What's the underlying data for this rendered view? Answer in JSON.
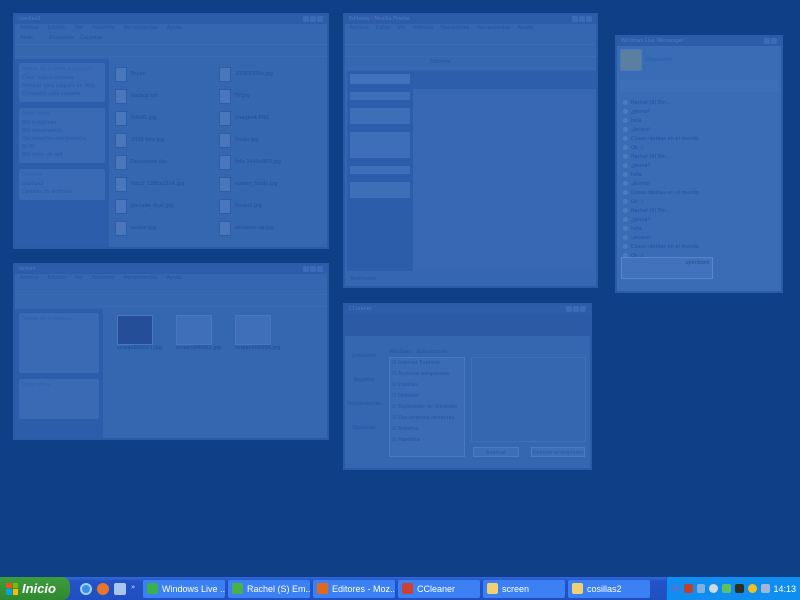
{
  "explorer1": {
    "title": "cosillas2",
    "menu": [
      "Archivo",
      "Edición",
      "Ver",
      "Favoritos",
      "Herramientas",
      "Ayuda"
    ],
    "toolbar": [
      "Atrás",
      "Búsqueda",
      "Carpetas"
    ],
    "tasks_title": "Tareas de archivo y carpeta",
    "tasks": [
      "Crear nueva carpeta",
      "Publicar esta carpeta en Web",
      "Compartir esta carpeta"
    ],
    "places_title": "Otros sitios",
    "places": [
      "Mis imágenes",
      "Mis documentos",
      "Documentos compartidos",
      "Mi PC",
      "Mis sitios de red"
    ],
    "details_title": "Detalles",
    "details": [
      "cosillas2",
      "Carpeta de archivos"
    ],
    "files": [
      "Bryan",
      "20081005b.jpg",
      "backup.txt",
      "TP.jpg",
      "foto01.jpg",
      "imagen4.PNG",
      "2008 foto.jpg",
      "fondo.jpg",
      "Document.doc",
      "foto 1440x900.jpg",
      "foto2_1280x1024.jpg",
      "screen_fondo.jpg",
      "portada_final.jpg",
      "fondo2.jpg",
      "avatar.jpg",
      "windows-xp.jpg"
    ]
  },
  "firefox": {
    "title": "Editores - Mozilla Firefox",
    "menu": [
      "Archivo",
      "Editar",
      "Ver",
      "Historial",
      "Marcadores",
      "Herramientas",
      "Ayuda"
    ],
    "tab": "Editores",
    "status": "Terminado"
  },
  "messenger": {
    "title": "Windows Live Messenger",
    "status": "Disponible",
    "ad_text": "openbank",
    "messages": [
      "Rachel (S) Em...",
      "¿Jenna?",
      "hola",
      "¡ánimo!",
      "Cosas rápidas en el mundo",
      "Ok :)"
    ]
  },
  "explorer2": {
    "title": "screen",
    "menu": [
      "Archivo",
      "Edición",
      "Ver",
      "Favoritos",
      "Herramientas",
      "Ayuda"
    ],
    "tasks_title": "Tareas de imágenes",
    "places_title": "Otros sitios",
    "files": [
      "screen000001.jpg",
      "screen000002.jpg",
      "screen000003.jpg"
    ]
  },
  "ccleaner": {
    "title": "CCleaner",
    "sidebar": [
      "Limpiador",
      "Registro",
      "Herramientas",
      "Opciones"
    ],
    "tabs": [
      "Windows",
      "Aplicaciones"
    ],
    "items": [
      "Internet Explorer",
      "Archivos temporales",
      "Cookies",
      "Historial",
      "Explorador de Windows",
      "Documentos recientes",
      "Sistema",
      "Papelera"
    ],
    "analyze": "Analizar",
    "run": "Ejecutar el limpiador"
  },
  "taskbar": {
    "start": "Inicio",
    "tasks": [
      {
        "label": "Windows Live ...",
        "color": "#3cb04a"
      },
      {
        "label": "Rachel (S) Em...",
        "color": "#4ab04a"
      },
      {
        "label": "Editores - Moz...",
        "color": "#e06a1a"
      },
      {
        "label": "CCleaner",
        "color": "#d04030"
      },
      {
        "label": "screen",
        "color": "#f0d070"
      },
      {
        "label": "cosillas2",
        "color": "#f0d070"
      }
    ],
    "clock": "14:13"
  }
}
